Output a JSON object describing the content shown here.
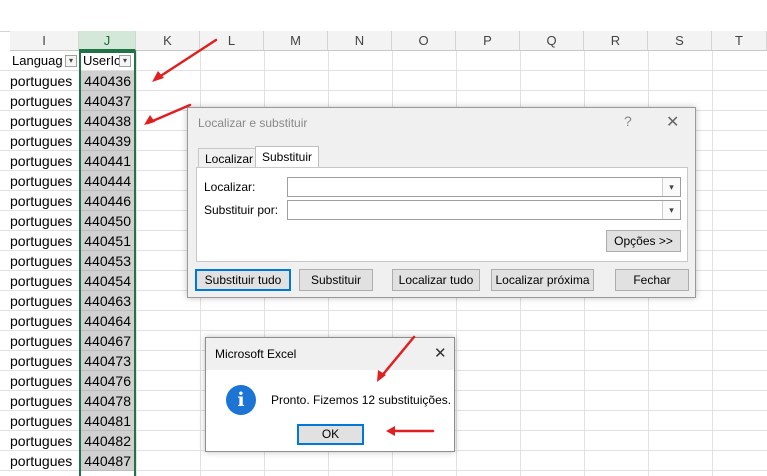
{
  "columns": [
    "I",
    "J",
    "K",
    "L",
    "M",
    "N",
    "O",
    "P",
    "Q",
    "R",
    "S",
    "T"
  ],
  "headers": {
    "language": "Languag",
    "userid": "UserIc"
  },
  "rows": [
    {
      "lang": "portugues",
      "uid": "440436"
    },
    {
      "lang": "portugues",
      "uid": "440437"
    },
    {
      "lang": "portugues",
      "uid": "440438"
    },
    {
      "lang": "portugues",
      "uid": "440439"
    },
    {
      "lang": "portugues",
      "uid": "440441"
    },
    {
      "lang": "portugues",
      "uid": "440444"
    },
    {
      "lang": "portugues",
      "uid": "440446"
    },
    {
      "lang": "portugues",
      "uid": "440450"
    },
    {
      "lang": "portugues",
      "uid": "440451"
    },
    {
      "lang": "portugues",
      "uid": "440453"
    },
    {
      "lang": "portugues",
      "uid": "440454"
    },
    {
      "lang": "portugues",
      "uid": "440463"
    },
    {
      "lang": "portugues",
      "uid": "440464"
    },
    {
      "lang": "portugues",
      "uid": "440467"
    },
    {
      "lang": "portugues",
      "uid": "440473"
    },
    {
      "lang": "portugues",
      "uid": "440476"
    },
    {
      "lang": "portugues",
      "uid": "440478"
    },
    {
      "lang": "portugues",
      "uid": "440481"
    },
    {
      "lang": "portugues",
      "uid": "440482"
    },
    {
      "lang": "portugues",
      "uid": "440487"
    }
  ],
  "find_replace": {
    "title": "Localizar e substituir",
    "help": "?",
    "close": "✕",
    "tab_find": "Localizar",
    "tab_replace": "Substituir",
    "find_label": "Localizar:",
    "replace_label": "Substituir por:",
    "find_value": "",
    "replace_value": "",
    "options_label": "Opções >>",
    "btn_replace_all": "Substituir tudo",
    "btn_replace": "Substituir",
    "btn_find_all": "Localizar tudo",
    "btn_find_next": "Localizar próxima",
    "btn_close": "Fechar"
  },
  "message_box": {
    "title": "Microsoft Excel",
    "close": "✕",
    "icon": "information-icon",
    "icon_glyph": "i",
    "text": "Pronto. Fizemos 12 substituições.",
    "ok": "OK"
  },
  "colors": {
    "selection_green": "#217346",
    "arrow_red": "#e02020",
    "info_blue": "#1c74d4",
    "focus_blue": "#0078d7"
  }
}
